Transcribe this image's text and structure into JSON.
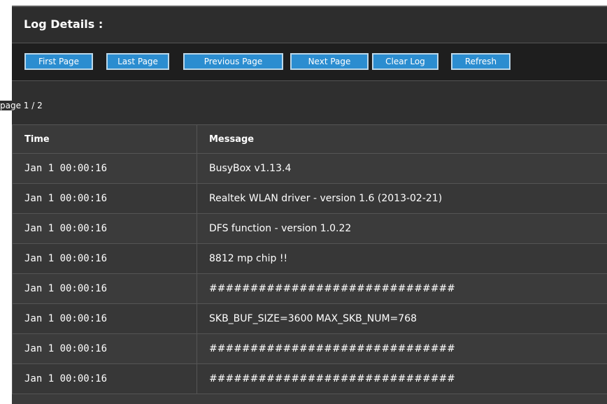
{
  "header": {
    "title": "Log Details :"
  },
  "toolbar": {
    "buttons": [
      {
        "label": "First Page"
      },
      {
        "label": "Last Page"
      },
      {
        "label": "Previous Page"
      },
      {
        "label": "Next Page"
      },
      {
        "label": "Clear Log"
      },
      {
        "label": "Refresh"
      }
    ]
  },
  "pager": {
    "text": "page 1 / 2"
  },
  "table": {
    "columns": [
      "Time",
      "Message"
    ],
    "rows": [
      {
        "time": "Jan 1 00:00:16",
        "message": "BusyBox v1.13.4"
      },
      {
        "time": "Jan 1 00:00:16",
        "message": "Realtek WLAN driver - version 1.6 (2013-02-21)"
      },
      {
        "time": "Jan 1 00:00:16",
        "message": "DFS function - version 1.0.22"
      },
      {
        "time": "Jan 1 00:00:16",
        "message": "8812 mp chip !!"
      },
      {
        "time": "Jan 1 00:00:16",
        "message": "##############################"
      },
      {
        "time": "Jan 1 00:00:16",
        "message": "SKB_BUF_SIZE=3600 MAX_SKB_NUM=768"
      },
      {
        "time": "Jan 1 00:00:16",
        "message": "##############################"
      },
      {
        "time": "Jan 1 00:00:16",
        "message": "##############################"
      }
    ]
  },
  "colors": {
    "button_bg": "#2b8dd0",
    "button_border": "#bcd8ea",
    "panel_bg": "#3b3b3b",
    "toolbar_bg": "#1e1e1e"
  }
}
